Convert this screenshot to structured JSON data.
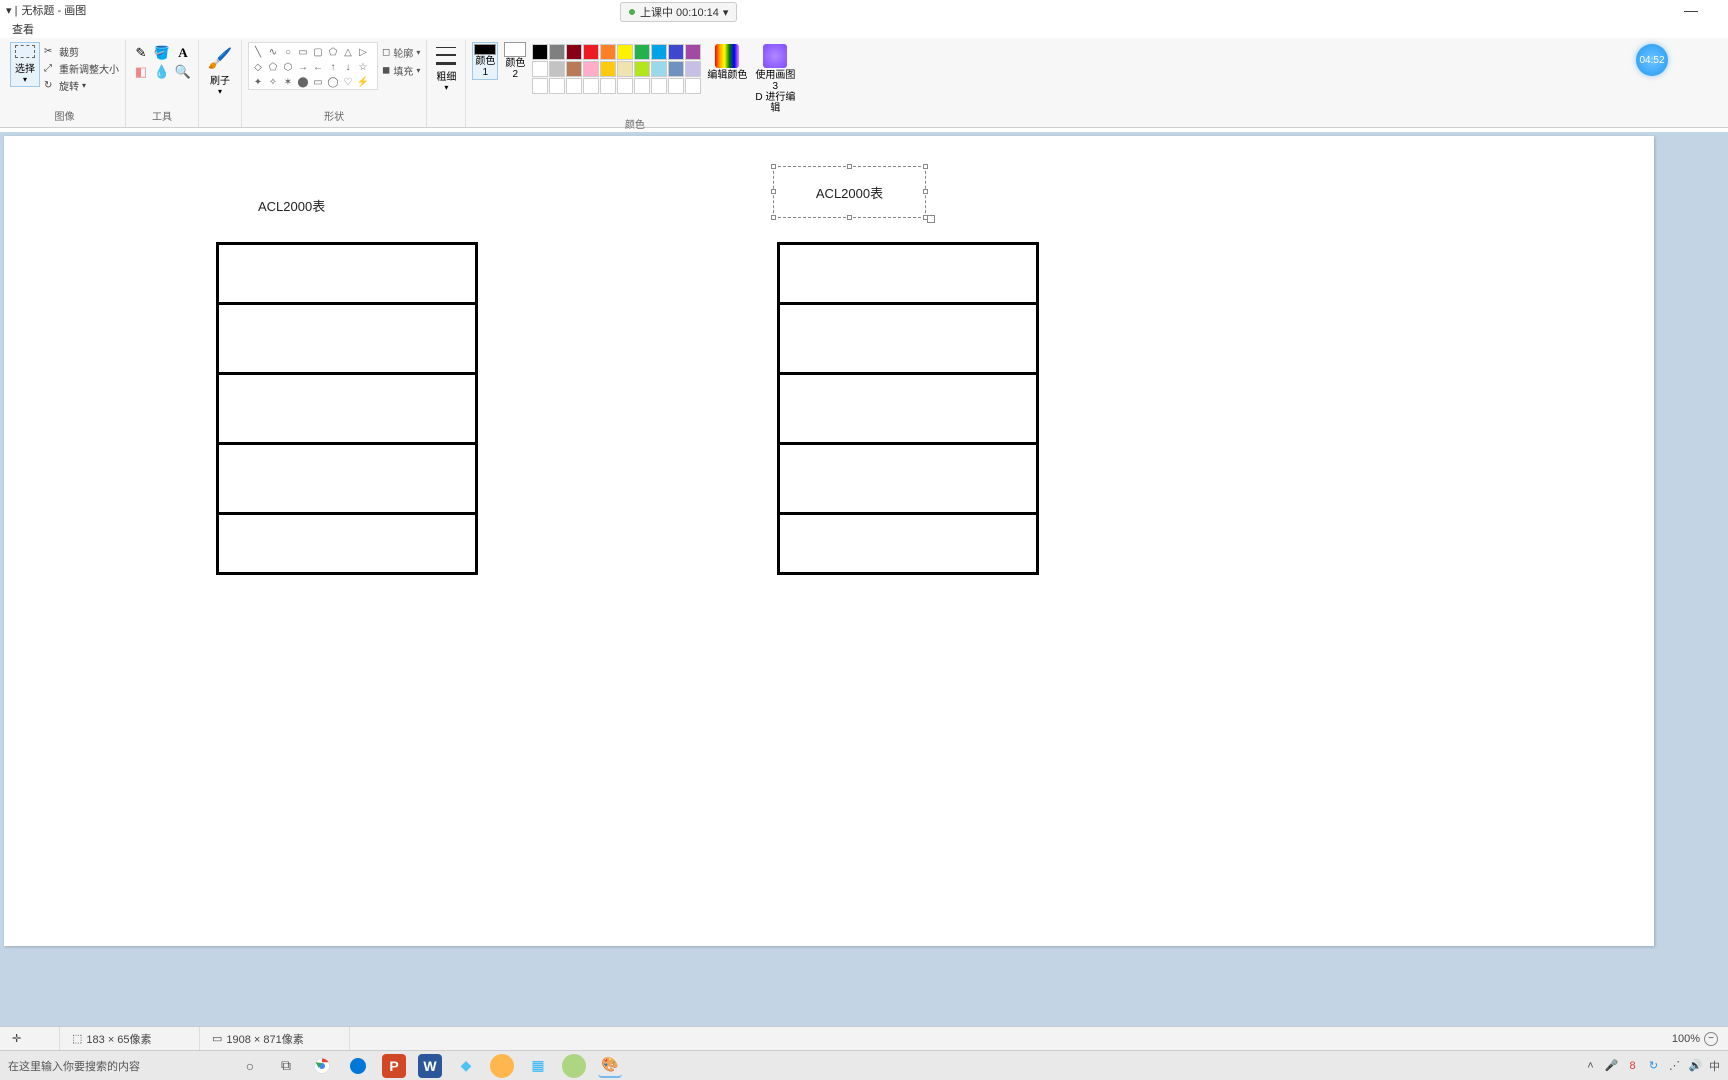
{
  "window": {
    "title": "无标题 - 画图",
    "session_status": "上课中 00:10:14"
  },
  "menu": {
    "view": "查看"
  },
  "ribbon": {
    "image": {
      "label": "图像",
      "select": "选择",
      "crop": "裁剪",
      "resize": "重新调整大小",
      "rotate": "旋转"
    },
    "tools": {
      "label": "工具"
    },
    "brushes": {
      "label": "刷子"
    },
    "shapes": {
      "label": "形状",
      "outline": "轮廓",
      "fill": "填充"
    },
    "stroke": {
      "label": "粗细"
    },
    "colors": {
      "label": "颜色",
      "color1": "颜色 1",
      "color2": "颜色 2",
      "edit": "编辑颜色",
      "palette_row1": [
        "#000000",
        "#7f7f7f",
        "#880015",
        "#ed1c24",
        "#ff7f27",
        "#fff200",
        "#22b14c",
        "#00a2e8",
        "#3f48cc",
        "#a349a4"
      ],
      "palette_row2": [
        "#ffffff",
        "#c3c3c3",
        "#b97a57",
        "#ffaec9",
        "#ffc90e",
        "#efe4b0",
        "#b5e61d",
        "#99d9ea",
        "#7092be",
        "#c8bfe7"
      ],
      "palette_row3": [
        "#ffffff",
        "#ffffff",
        "#ffffff",
        "#ffffff",
        "#ffffff",
        "#ffffff",
        "#ffffff",
        "#ffffff",
        "#ffffff",
        "#ffffff"
      ]
    },
    "paint3d": {
      "line1": "使用画图 3",
      "line2": "D 进行编辑"
    }
  },
  "timer": "04:52",
  "canvas": {
    "label_left": "ACL2000表",
    "label_right": "ACL2000表"
  },
  "statusbar": {
    "selection_size": "183 × 65像素",
    "canvas_size": "1908 × 871像素",
    "zoom": "100%"
  },
  "taskbar": {
    "search_placeholder": "在这里输入你要搜索的内容",
    "ime": "中"
  }
}
